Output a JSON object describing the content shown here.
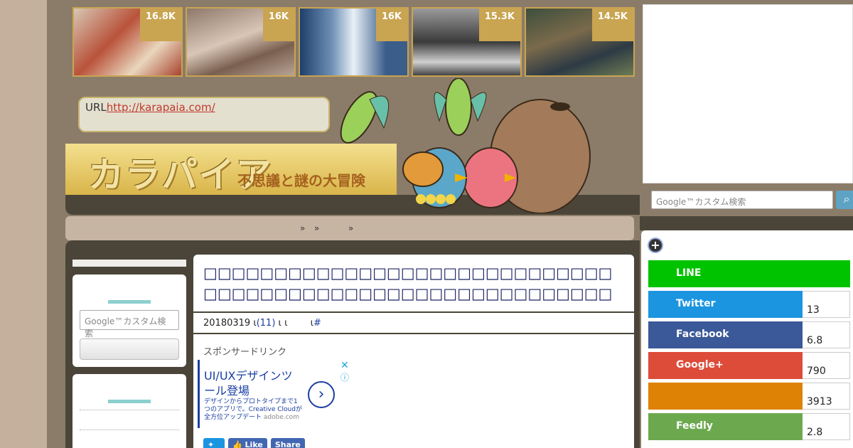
{
  "thumbnails": [
    {
      "count": "16.8K",
      "name": "thumb-egypt"
    },
    {
      "count": "16K",
      "name": "thumb-sparrows"
    },
    {
      "count": "16K",
      "name": "thumb-lighthouse"
    },
    {
      "count": "15.3K",
      "name": "thumb-forest"
    },
    {
      "count": "14.5K",
      "name": "thumb-fantasy"
    }
  ],
  "header": {
    "url_label": "URL",
    "url_link": "http://karapaia.com/",
    "logo_text": "カラパイア",
    "tagline": "不思議と謎の大冒険"
  },
  "breadcrumb": {
    "sep1": "»",
    "sep2": "»",
    "sep3": "»"
  },
  "sidebar": {
    "search_placeholder": "Google™カスタム検索"
  },
  "article": {
    "title": "□□□□□□□□□□□□□□□□□□□□□□□□□□□□□□□□□□□□□□□□□□□□□□□□□□□□□□□□□□",
    "date": "20180319",
    "sep1": "ι",
    "comments": "(11)",
    "sep2": "ι ι",
    "sep3": "ι",
    "hash": "#",
    "sponsor_label": "スポンサードリンク",
    "ad_title": "UI/UXデザインツール登場",
    "ad_body": "デザインからプロトタイプまで1つのアプリで。Creative Cloudが全方位アップデート",
    "ad_domain": "adobe.com",
    "share_like": "Like",
    "share_share": "Share"
  },
  "right": {
    "search_placeholder": "Google™カスタム検索",
    "sns": [
      {
        "label": "LINE",
        "count": "",
        "color": "#00c300"
      },
      {
        "label": "Twitter",
        "count": "13",
        "color": "#1b95e0"
      },
      {
        "label": "Facebook",
        "count": "6.8",
        "color": "#3b5998"
      },
      {
        "label": "Google+",
        "count": "790",
        "color": "#dd4b39"
      },
      {
        "label": "",
        "count": "3913",
        "color": "#dd8204"
      },
      {
        "label": "Feedly",
        "count": "2.8",
        "color": "#6cc655"
      }
    ]
  }
}
